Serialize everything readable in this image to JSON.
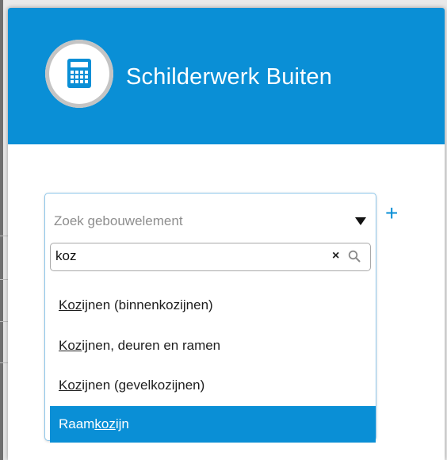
{
  "header": {
    "title": "Schilderwerk Buiten"
  },
  "icons": {
    "calculator": "calculator-icon",
    "add": "plus-icon",
    "dropdown": "caret-down-icon",
    "clear": "clear-icon",
    "search": "search-icon"
  },
  "colors": {
    "accent": "#0a8fd6",
    "avatar_ring": "#c4c4c4"
  },
  "select": {
    "placeholder": "Zoek gebouwelement",
    "search_value": "koz",
    "clear_glyph": "×",
    "add_glyph": "+",
    "options": [
      {
        "match": "Koz",
        "rest": "ijnen (binnenkozijnen)",
        "pre": ""
      },
      {
        "match": "Koz",
        "rest": "ijnen, deuren en ramen",
        "pre": ""
      },
      {
        "match": "Koz",
        "rest": "ijnen (gevelkozijnen)",
        "pre": ""
      },
      {
        "pre": "Raam",
        "match": "koz",
        "rest": "ijn",
        "highlighted": true
      }
    ]
  }
}
